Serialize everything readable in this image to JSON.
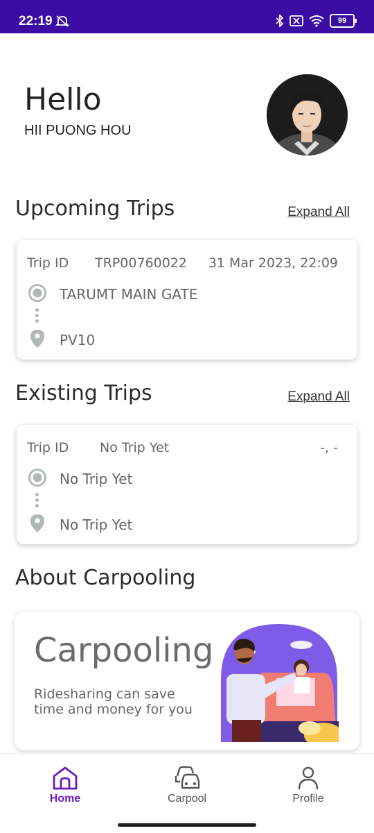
{
  "status_bar": {
    "time": "22:19",
    "battery": "99",
    "background": "#3a0ca3"
  },
  "header": {
    "greeting": "Hello",
    "user_name": "HII PUONG HOU"
  },
  "upcoming": {
    "title": "Upcoming Trips",
    "expand_label": "Expand All",
    "trip": {
      "id_label": "Trip ID",
      "id_value": "TRP00760022",
      "datetime": "31 Mar 2023, 22:09",
      "pickup": "TARUMT MAIN GATE",
      "dropoff": "PV10"
    }
  },
  "existing": {
    "title": "Existing Trips",
    "expand_label": "Expand All",
    "trip": {
      "id_label": "Trip ID",
      "id_value": "No Trip Yet",
      "datetime": "-, -",
      "pickup": "No Trip Yet",
      "dropoff": "No Trip Yet"
    }
  },
  "about": {
    "title": "About Carpooling",
    "card_heading": "Carpooling",
    "card_text": "Ridesharing can save time and money for you"
  },
  "bottom_nav": {
    "items": [
      {
        "label": "Home",
        "icon": "home-icon",
        "active": true
      },
      {
        "label": "Carpool",
        "icon": "car-icon",
        "active": false
      },
      {
        "label": "Profile",
        "icon": "person-icon",
        "active": false
      }
    ],
    "active_color": "#6a1bbf"
  }
}
